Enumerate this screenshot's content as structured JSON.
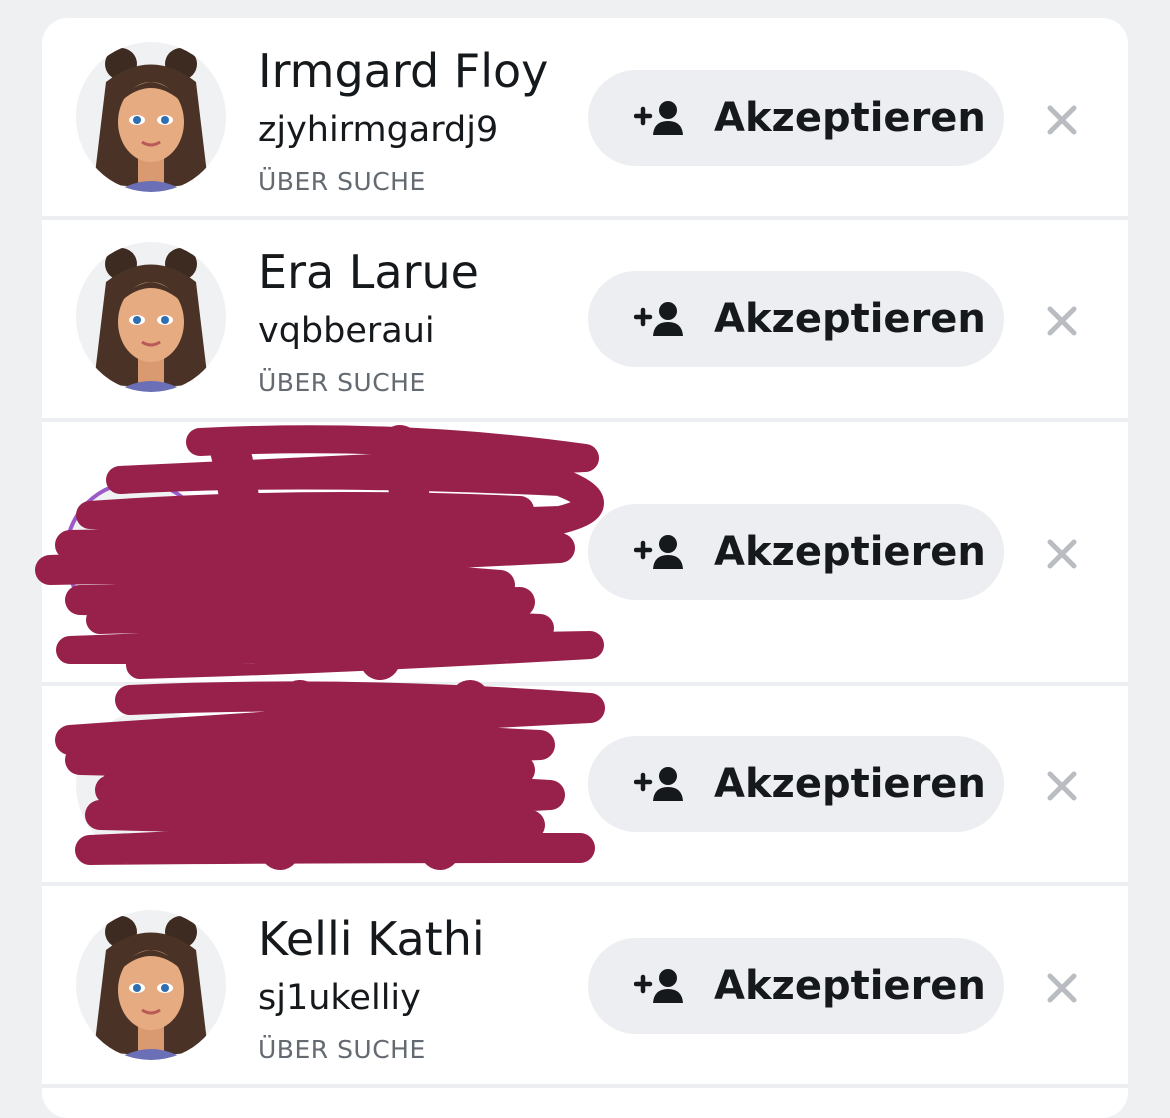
{
  "requests": [
    {
      "name": "Irmgard Floy",
      "username": "zjyhirmgardj9",
      "source": "ÜBER SUCHE",
      "accept_label": "Akzeptieren"
    },
    {
      "name": "Era Larue",
      "username": "vqbberaui",
      "source": "ÜBER SUCHE",
      "accept_label": "Akzeptieren"
    },
    {
      "name": "",
      "username": "",
      "source": "",
      "accept_label": "Akzeptieren"
    },
    {
      "name": "",
      "username": "",
      "source": "",
      "accept_label": "Akzeptieren"
    },
    {
      "name": "Kelli Kathi",
      "username": "sj1ukelliy",
      "source": "ÜBER SUCHE",
      "accept_label": "Akzeptieren"
    }
  ],
  "icons": {
    "accept": "add-friend-icon",
    "dismiss": "close-icon",
    "avatar": "bitmoji-avatar"
  },
  "colors": {
    "redaction": "#98214c",
    "button_bg": "#edeef1",
    "dismiss": "#b9bdc2",
    "story_ring": "#9b59c9"
  }
}
